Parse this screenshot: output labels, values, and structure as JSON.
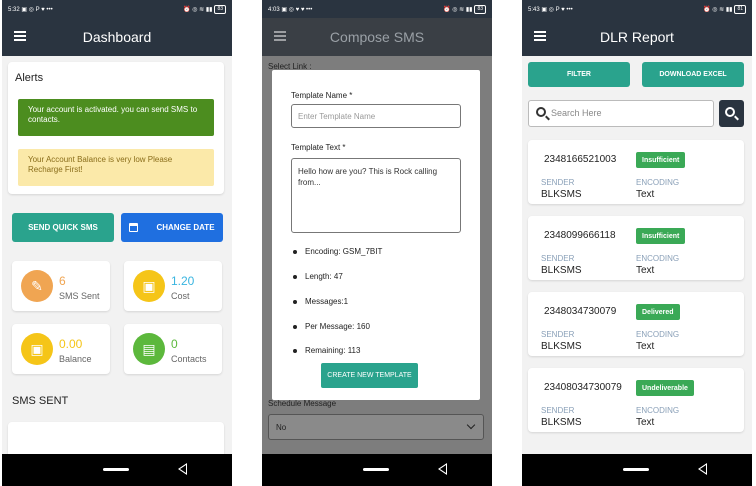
{
  "phones": {
    "dashboard": {
      "status": {
        "time": "5:32",
        "left_icons": "▣ ◎ P ♥ •••",
        "right_icons": "⏰ ◎ ≋ ▮▮",
        "batt": "83"
      },
      "title": "Dashboard",
      "alerts_title": "Alerts",
      "alert_success": "Your account is activated. you can send SMS to contacts.",
      "alert_warning": "Your Account Balance is very low Please Recharge First!",
      "send_quick_sms": "SEND QUICK SMS",
      "change_date": "CHANGE DATE",
      "stats": [
        {
          "value": "6",
          "label": "SMS Sent",
          "icon": "edit-icon",
          "icon_color": "#f0a552",
          "value_color": "#f0a552"
        },
        {
          "value": "1.20",
          "label": "Cost",
          "icon": "wallet-icon",
          "icon_color": "#f5c518",
          "value_color": "#3ab5e0"
        },
        {
          "value": "0.00",
          "label": "Balance",
          "icon": "wallet-icon",
          "icon_color": "#f5c518",
          "value_color": "#f5c518"
        },
        {
          "value": "0",
          "label": "Contacts",
          "icon": "contacts-icon",
          "icon_color": "#5cb83c",
          "value_color": "#5cb83c"
        }
      ],
      "section_title": "SMS SENT"
    },
    "compose": {
      "status": {
        "time": "4:03",
        "left_icons": "▣ ◎ ♥ ♥ •••",
        "right_icons": "⏰ ◎ ≋ ▮▮",
        "batt": "83"
      },
      "title": "Compose SMS",
      "select_link_label": "Select Link :",
      "schedule_label": "Schedule Message",
      "schedule_value": "No",
      "modal": {
        "template_name_label": "Template Name *",
        "template_name_placeholder": "Enter Template Name",
        "template_text_label": "Template Text *",
        "template_text_value": "Hello how are you? This is Rock calling from...",
        "encoding": "Encoding:   GSM_7BIT",
        "length": "Length:  47",
        "messages": "Messages:1",
        "per_message": "Per Message:  160",
        "remaining": "Remaining: 113",
        "button": "CREATE NEW TEMPLATE"
      }
    },
    "dlr": {
      "status": {
        "time": "5:43",
        "left_icons": "▣ ◎ P ♥ •••",
        "right_icons": "⏰ ◎ ≋ ▮▮",
        "batt": "81"
      },
      "title": "DLR Report",
      "filter": "FILTER",
      "download_excel": "DOWNLOAD EXCEL",
      "search_placeholder": "Search Here",
      "sender_label": "SENDER",
      "encoding_label": "ENCODING",
      "reports": [
        {
          "number": "2348166521003",
          "status": "Insufficient",
          "status_color": "#3aa956",
          "sender": "BLKSMS",
          "encoding": "Text"
        },
        {
          "number": "2348099666118",
          "status": "Insufficient",
          "status_color": "#3aa956",
          "sender": "BLKSMS",
          "encoding": "Text"
        },
        {
          "number": "2348034730079",
          "status": "Delivered",
          "status_color": "#3aa956",
          "sender": "BLKSMS",
          "encoding": "Text"
        },
        {
          "number": "23408034730079",
          "status": "Undeliverable",
          "status_color": "#3aa956",
          "sender": "BLKSMS",
          "encoding": "Text"
        }
      ]
    }
  }
}
